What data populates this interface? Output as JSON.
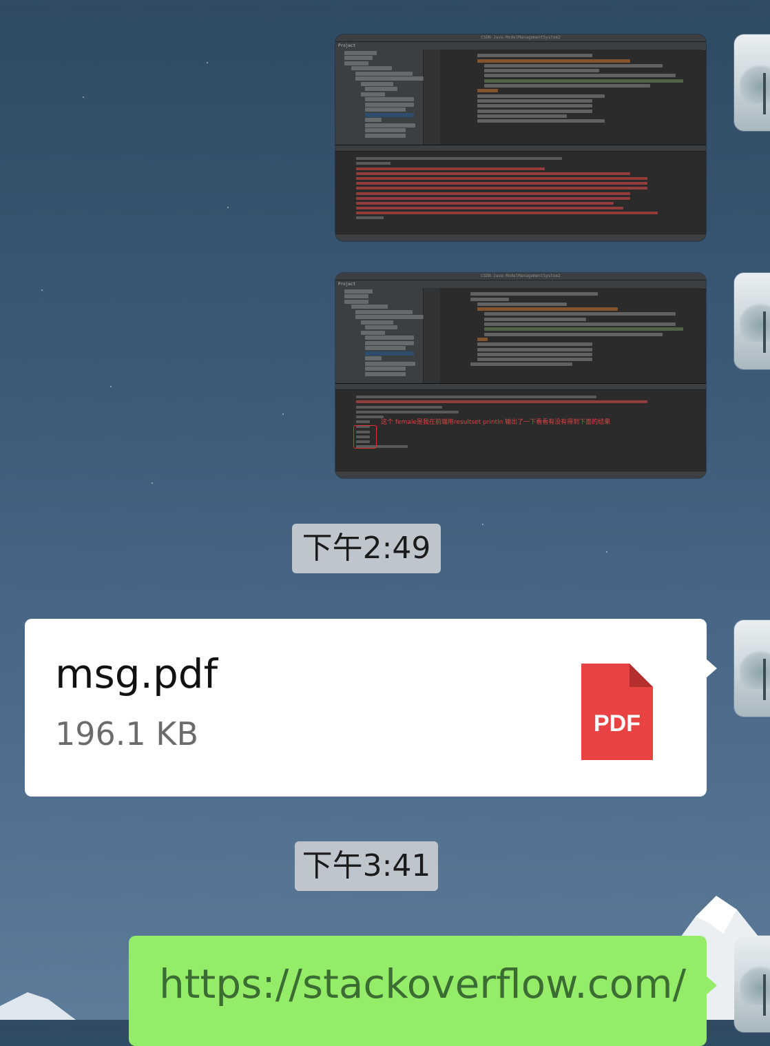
{
  "messages": [
    {
      "type": "image",
      "ide_title": "CSDN-Java-ModelManagementSystem2",
      "project_label": "Project",
      "run_label": "Run"
    },
    {
      "type": "image",
      "ide_title": "CSDN-Java-ModelManagementSystem2",
      "project_label": "Project",
      "run_label": "Run",
      "annotation": "这个 female是我在前端用resultset println 输出了一下看看有没有得到下面的结果"
    },
    {
      "type": "timestamp",
      "text": "下午2:49"
    },
    {
      "type": "file",
      "file_name": "msg.pdf",
      "file_size": "196.1 KB",
      "file_icon_label": "PDF",
      "icon_color": "#e94242"
    },
    {
      "type": "timestamp",
      "text": "下午3:41"
    },
    {
      "type": "link",
      "text": "https://stackoverflow.com/"
    }
  ],
  "colors": {
    "incoming_bubble": "#ffffff",
    "outgoing_bubble": "#95ec69",
    "timestamp_bg": "#bfc5cd",
    "background": "#3b5976"
  },
  "icons": {
    "file": "pdf-file-icon",
    "avatar": "avatar-landscape"
  }
}
